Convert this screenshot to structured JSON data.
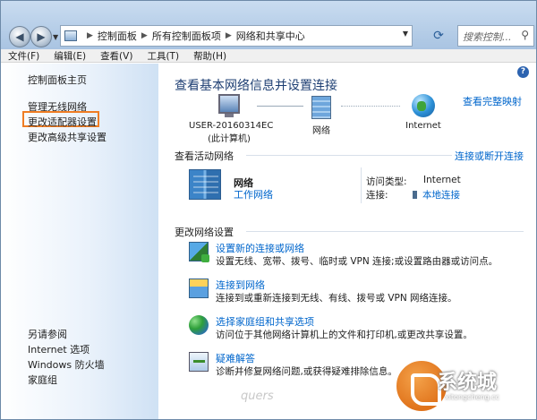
{
  "address": {
    "crumbs": [
      "控制面板",
      "所有控制面板项",
      "网络和共享中心"
    ],
    "search_placeholder": "搜索控制..."
  },
  "menu": [
    "文件(F)",
    "编辑(E)",
    "查看(V)",
    "工具(T)",
    "帮助(H)"
  ],
  "sidebar": {
    "home": "控制面板主页",
    "links": [
      "管理无线网络",
      "更改适配器设置",
      "更改高级共享设置"
    ],
    "see_also_title": "另请参阅",
    "see_also": [
      "Internet 选项",
      "Windows 防火墙",
      "家庭组"
    ]
  },
  "main": {
    "heading": "查看基本网络信息并设置连接",
    "full_map": "查看完整映射",
    "map": {
      "computer": [
        "USER-20160314EC",
        "(此计算机)"
      ],
      "network": "网络",
      "internet": "Internet"
    },
    "active_title": "查看活动网络",
    "connect_disconnect": "连接或断开连接",
    "active": {
      "name": "网络",
      "type": "工作网络",
      "access_label": "访问类型:",
      "access_value": "Internet",
      "conn_label": "连接:",
      "conn_value": "本地连接"
    },
    "change_title": "更改网络设置",
    "tasks": [
      {
        "title": "设置新的连接或网络",
        "desc": "设置无线、宽带、拨号、临时或 VPN 连接;或设置路由器或访问点。"
      },
      {
        "title": "连接到网络",
        "desc": "连接到或重新连接到无线、有线、拨号或 VPN 网络连接。"
      },
      {
        "title": "选择家庭组和共享选项",
        "desc": "访问位于其他网络计算机上的文件和打印机,或更改共享设置。"
      },
      {
        "title": "疑难解答",
        "desc": "诊断并修复网络问题,或获得疑难排除信息。"
      }
    ]
  },
  "watermark": {
    "text": "quers",
    "brand": "系统城",
    "url": "xitongcheng.cc"
  },
  "colors": {
    "link": "#0066cc",
    "heading": "#1e3f73",
    "highlight_box": "#ef7d24"
  }
}
